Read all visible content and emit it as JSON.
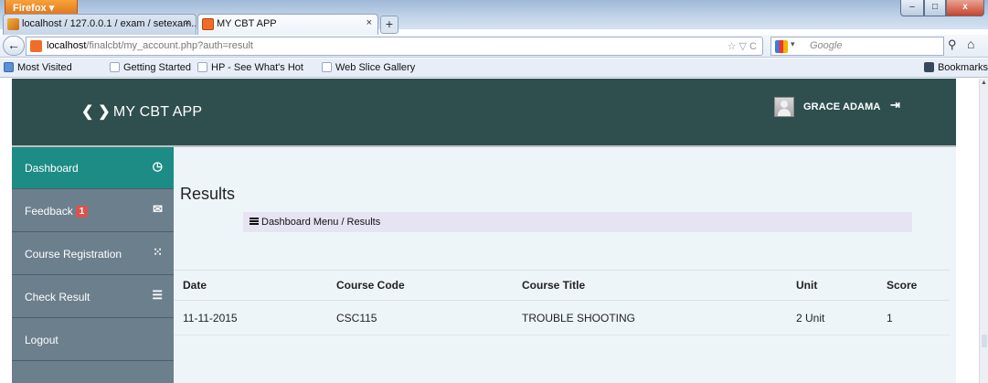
{
  "browser": {
    "menu_button": "Firefox",
    "tabs": [
      {
        "label": "localhost / 127.0.0.1 / exam / setexam...",
        "close": "×"
      },
      {
        "label": "MY CBT APP",
        "close": "×"
      }
    ],
    "new_tab": "+",
    "url_host": "localhost",
    "url_path": "/finalcbt/my_account.php?auth=result",
    "url_controls": "☆ ▽ C",
    "search_placeholder": "Google",
    "window_controls": {
      "minimize": "–",
      "maximize": "□",
      "close": "x"
    },
    "bookmarks": [
      "Most Visited",
      "Getting Started",
      "HP - See What's Hot",
      "Web Slice Gallery"
    ],
    "bookmarks_menu": "Bookmarks"
  },
  "header": {
    "brand": "MY CBT APP",
    "brand_arrows": "❮ ❯",
    "username": "GRACE ADAMA"
  },
  "sidebar": {
    "items": [
      {
        "label": "Dashboard",
        "icon": "clock-icon",
        "active": true
      },
      {
        "label": "Feedback",
        "badge": "1",
        "icon": "envelope-icon"
      },
      {
        "label": "Course Registration",
        "icon": "grid-icon"
      },
      {
        "label": "Check Result",
        "icon": "list-icon"
      },
      {
        "label": "Logout"
      }
    ]
  },
  "main": {
    "title": "Results",
    "breadcrumb": "Dashboard Menu / Results",
    "table": {
      "headers": [
        "Date",
        "Course Code",
        "Course Title",
        "Unit",
        "Score"
      ],
      "rows": [
        [
          "11-11-2015",
          "CSC115",
          "TROUBLE SHOOTING",
          "2 Unit",
          "1"
        ]
      ]
    }
  },
  "colors": {
    "header_bg": "#2f4f4f",
    "sidebar_bg": "#6c7f8d",
    "sidebar_active": "#1c8c84",
    "content_bg": "#eef5f9",
    "badge": "#d9534f"
  }
}
